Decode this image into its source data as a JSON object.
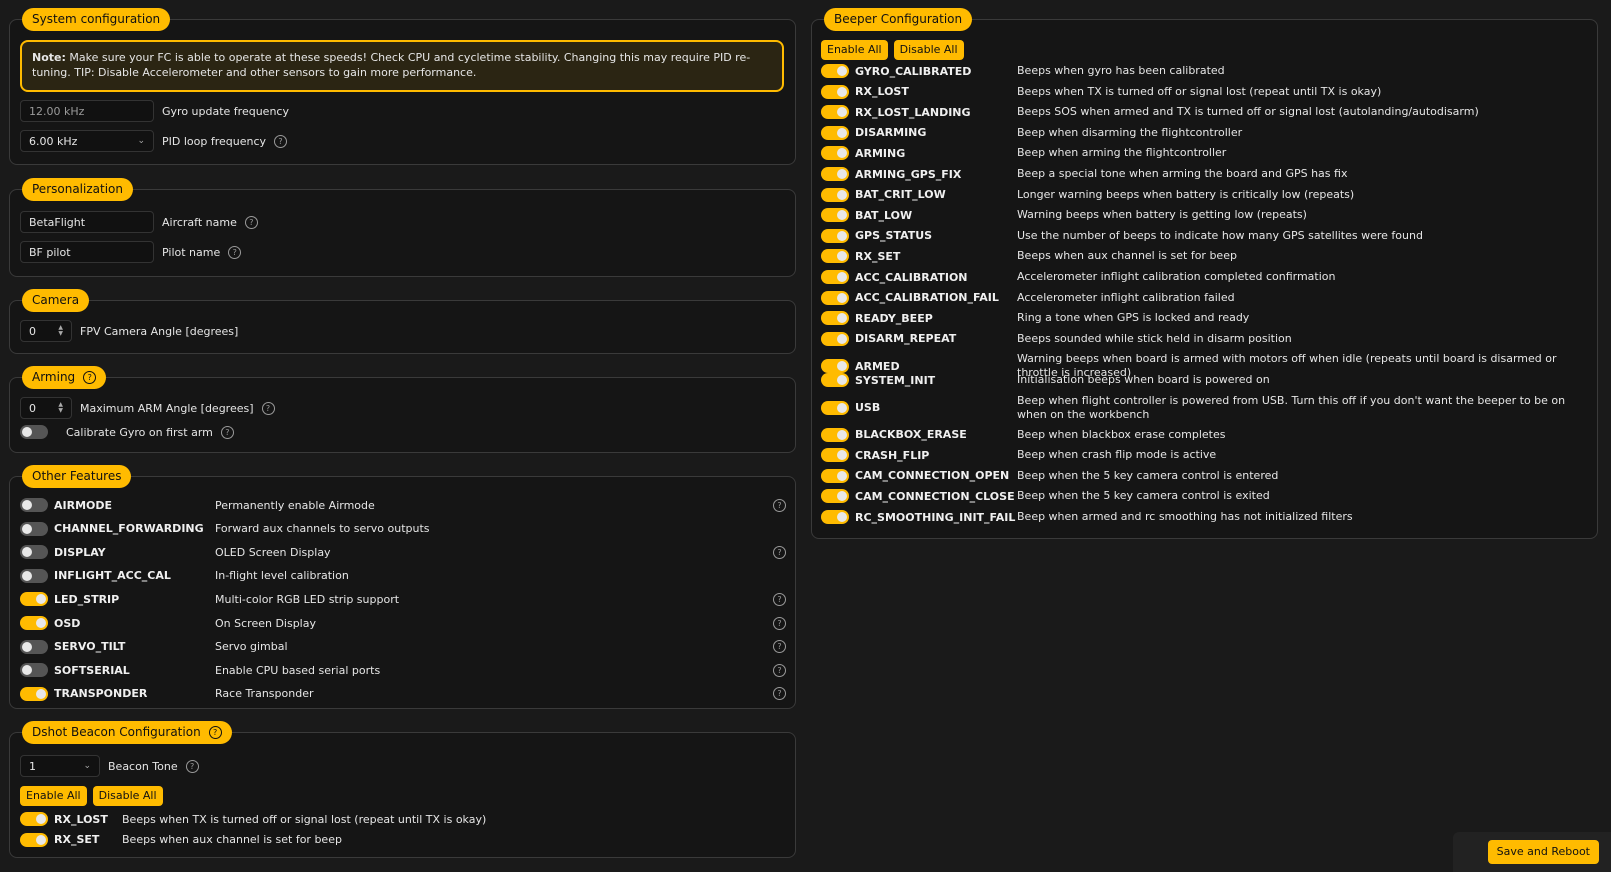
{
  "system": {
    "legend": "System configuration",
    "note_bold": "Note:",
    "note_text": " Make sure your FC is able to operate at these speeds! Check CPU and cycletime stability. Changing this may require PID re-tuning. TIP: Disable Accelerometer and other sensors to gain more performance.",
    "gyro_value": "12.00 kHz",
    "gyro_label": "Gyro update frequency",
    "pid_value": "6.00 kHz",
    "pid_label": "PID loop frequency"
  },
  "personalization": {
    "legend": "Personalization",
    "aircraft_value": "BetaFlight",
    "aircraft_label": "Aircraft name",
    "pilot_value": "BF pilot",
    "pilot_label": "Pilot name"
  },
  "camera": {
    "legend": "Camera",
    "angle_value": "0",
    "angle_label": "FPV Camera Angle [degrees]"
  },
  "arming": {
    "legend": "Arming",
    "max_angle_value": "0",
    "max_angle_label": "Maximum ARM Angle [degrees]",
    "calibrate_label": "Calibrate Gyro on first arm"
  },
  "other_features": {
    "legend": "Other Features",
    "items": [
      {
        "name": "AIRMODE",
        "desc": "Permanently enable Airmode"
      },
      {
        "name": "CHANNEL_FORWARDING",
        "desc": "Forward aux channels to servo outputs"
      },
      {
        "name": "DISPLAY",
        "desc": "OLED Screen Display"
      },
      {
        "name": "INFLIGHT_ACC_CAL",
        "desc": "In-flight level calibration"
      },
      {
        "name": "LED_STRIP",
        "desc": "Multi-color RGB LED strip support"
      },
      {
        "name": "OSD",
        "desc": "On Screen Display"
      },
      {
        "name": "SERVO_TILT",
        "desc": "Servo gimbal"
      },
      {
        "name": "SOFTSERIAL",
        "desc": "Enable CPU based serial ports"
      },
      {
        "name": "TRANSPONDER",
        "desc": "Race Transponder"
      }
    ]
  },
  "dshot": {
    "legend": "Dshot Beacon Configuration",
    "tone_value": "1",
    "tone_label": "Beacon Tone",
    "enable_all": "Enable All",
    "disable_all": "Disable All",
    "items": [
      {
        "name": "RX_LOST",
        "desc": "Beeps when TX is turned off or signal lost (repeat until TX is okay)"
      },
      {
        "name": "RX_SET",
        "desc": "Beeps when aux channel is set for beep"
      }
    ]
  },
  "beeper": {
    "legend": "Beeper Configuration",
    "enable_all": "Enable All",
    "disable_all": "Disable All",
    "items": [
      {
        "name": "GYRO_CALIBRATED",
        "desc": "Beeps when gyro has been calibrated"
      },
      {
        "name": "RX_LOST",
        "desc": "Beeps when TX is turned off or signal lost (repeat until TX is okay)"
      },
      {
        "name": "RX_LOST_LANDING",
        "desc": "Beeps SOS when armed and TX is turned off or signal lost (autolanding/autodisarm)"
      },
      {
        "name": "DISARMING",
        "desc": "Beep when disarming the flightcontroller"
      },
      {
        "name": "ARMING",
        "desc": "Beep when arming the flightcontroller"
      },
      {
        "name": "ARMING_GPS_FIX",
        "desc": "Beep a special tone when arming the board and GPS has fix"
      },
      {
        "name": "BAT_CRIT_LOW",
        "desc": "Longer warning beeps when battery is critically low (repeats)"
      },
      {
        "name": "BAT_LOW",
        "desc": "Warning beeps when battery is getting low (repeats)"
      },
      {
        "name": "GPS_STATUS",
        "desc": "Use the number of beeps to indicate how many GPS satellites were found"
      },
      {
        "name": "RX_SET",
        "desc": "Beeps when aux channel is set for beep"
      },
      {
        "name": "ACC_CALIBRATION",
        "desc": "Accelerometer inflight calibration completed confirmation"
      },
      {
        "name": "ACC_CALIBRATION_FAIL",
        "desc": "Accelerometer inflight calibration failed"
      },
      {
        "name": "READY_BEEP",
        "desc": "Ring a tone when GPS is locked and ready"
      },
      {
        "name": "DISARM_REPEAT",
        "desc": "Beeps sounded while stick held in disarm position"
      },
      {
        "name": "ARMED",
        "desc": "Warning beeps when board is armed with motors off when idle (repeats until board is disarmed or throttle is increased)"
      },
      {
        "name": "SYSTEM_INIT",
        "desc": "Initialisation beeps when board is powered on"
      },
      {
        "name": "USB",
        "desc": "Beep when flight controller is powered from USB. Turn this off if you don't want the beeper to be on when on the workbench"
      },
      {
        "name": "BLACKBOX_ERASE",
        "desc": "Beep when blackbox erase completes"
      },
      {
        "name": "CRASH_FLIP",
        "desc": "Beep when crash flip mode is active"
      },
      {
        "name": "CAM_CONNECTION_OPEN",
        "desc": "Beep when the 5 key camera control is entered"
      },
      {
        "name": "CAM_CONNECTION_CLOSE",
        "desc": "Beep when the 5 key camera control is exited"
      },
      {
        "name": "RC_SMOOTHING_INIT_FAIL",
        "desc": "Beep when armed and rc smoothing has not initialized filters"
      }
    ]
  },
  "save_reboot": "Save and Reboot",
  "colors": {
    "accent": "#ffbb00",
    "background": "#1a1a1a"
  },
  "icons": {
    "help": "question-circle-icon"
  }
}
